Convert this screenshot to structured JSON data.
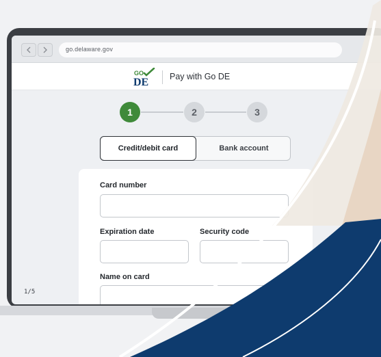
{
  "browser": {
    "url": "go.delaware.gov",
    "back_icon": "chevron-left-icon",
    "forward_icon": "chevron-right-icon"
  },
  "header": {
    "logo_top": "GO",
    "logo_bottom": "DE",
    "title": "Pay with Go DE"
  },
  "stepper": {
    "steps": [
      "1",
      "2",
      "3"
    ],
    "active_step": 1
  },
  "payment_tabs": {
    "items": [
      "Credit/debit card",
      "Bank account"
    ],
    "selected": "Credit/debit card"
  },
  "form": {
    "card_number_label": "Card number",
    "card_number_value": "",
    "expiration_label": "Expiration date",
    "expiration_value": "",
    "security_label": "Security code",
    "security_value": "",
    "name_label": "Name on card",
    "name_value": ""
  },
  "page_counter": "1/5",
  "colors": {
    "accent_green": "#3f8a3a",
    "navy": "#0e3b6e",
    "frame": "#3b3e43",
    "background": "#f1f2f4"
  }
}
